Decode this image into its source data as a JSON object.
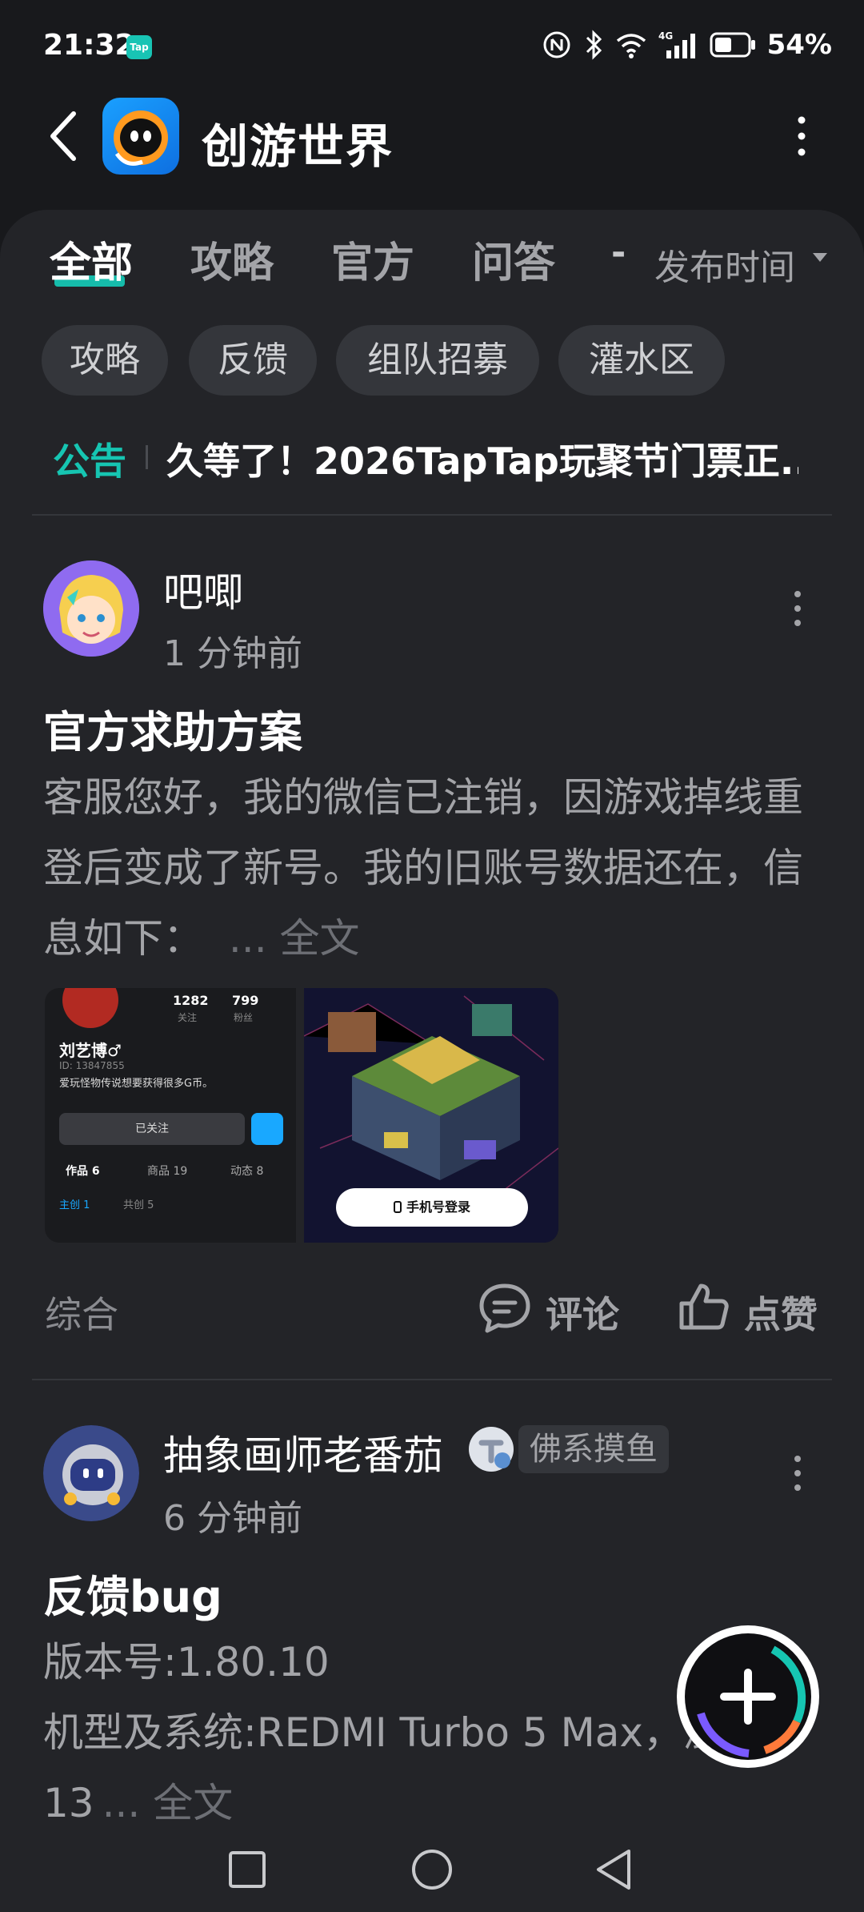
{
  "status_bar": {
    "time": "21:32",
    "tap_badge": "Tap",
    "battery_percent": "54%",
    "icons": [
      "nfc-icon",
      "bluetooth-icon",
      "wifi-icon",
      "signal-4g-icon",
      "battery-icon"
    ]
  },
  "header": {
    "title": "创游世界",
    "back_icon": "chevron-left-icon",
    "more_icon": "more-vertical-icon"
  },
  "tabs": [
    {
      "label": "全部",
      "active": true
    },
    {
      "label": "攻略",
      "active": false
    },
    {
      "label": "官方",
      "active": false
    },
    {
      "label": "问答",
      "active": false
    }
  ],
  "sort": {
    "dash": "-",
    "label": "发布时间"
  },
  "chips": [
    "攻略",
    "反馈",
    "组队招募",
    "灌水区"
  ],
  "notice": {
    "label": "公告",
    "text": "久等了！2026TapTap玩聚节门票正..."
  },
  "posts": [
    {
      "author": "吧唧",
      "time": "1 分钟前",
      "title": "官方求助方案",
      "body": "客服您好，我的微信已注销，因游戏掉线重登后变成了新号。我的旧账号数据还在，信息如下：",
      "more": "... 全文",
      "category": "综合",
      "comment_label": "评论",
      "like_label": "点赞",
      "screenshot": {
        "following": "1282",
        "following_label": "关注",
        "fans": "799",
        "fans_label": "粉丝",
        "name": "刘艺博♂",
        "id": "ID: 13847855",
        "bio": "爱玩怪物传说想要获得很多G币。",
        "follow_btn": "已关注",
        "tab_works": "作品 6",
        "tab_goods": "商品 19",
        "tab_dynamic": "动态 8",
        "sub_main": "主创 1",
        "sub_co": "共创 5",
        "phone_login": "手机号登录"
      }
    },
    {
      "author": "抽象画师老番茄",
      "badge": "佛系摸鱼",
      "time": "6 分钟前",
      "title": "反馈bug",
      "body_line1": "版本号:1.80.10",
      "body_line2": "机型及系统:REDMI Turbo 5 Max，澎湃",
      "body_line3": "13",
      "more": "... 全文"
    }
  ],
  "fab": {
    "icon": "plus-icon"
  },
  "nav": [
    "recent-apps-icon",
    "home-icon",
    "back-icon"
  ],
  "colors": {
    "accent": "#16c5b2",
    "background": "#18191c",
    "panel": "#232428",
    "muted_text": "#a3a4a8"
  }
}
